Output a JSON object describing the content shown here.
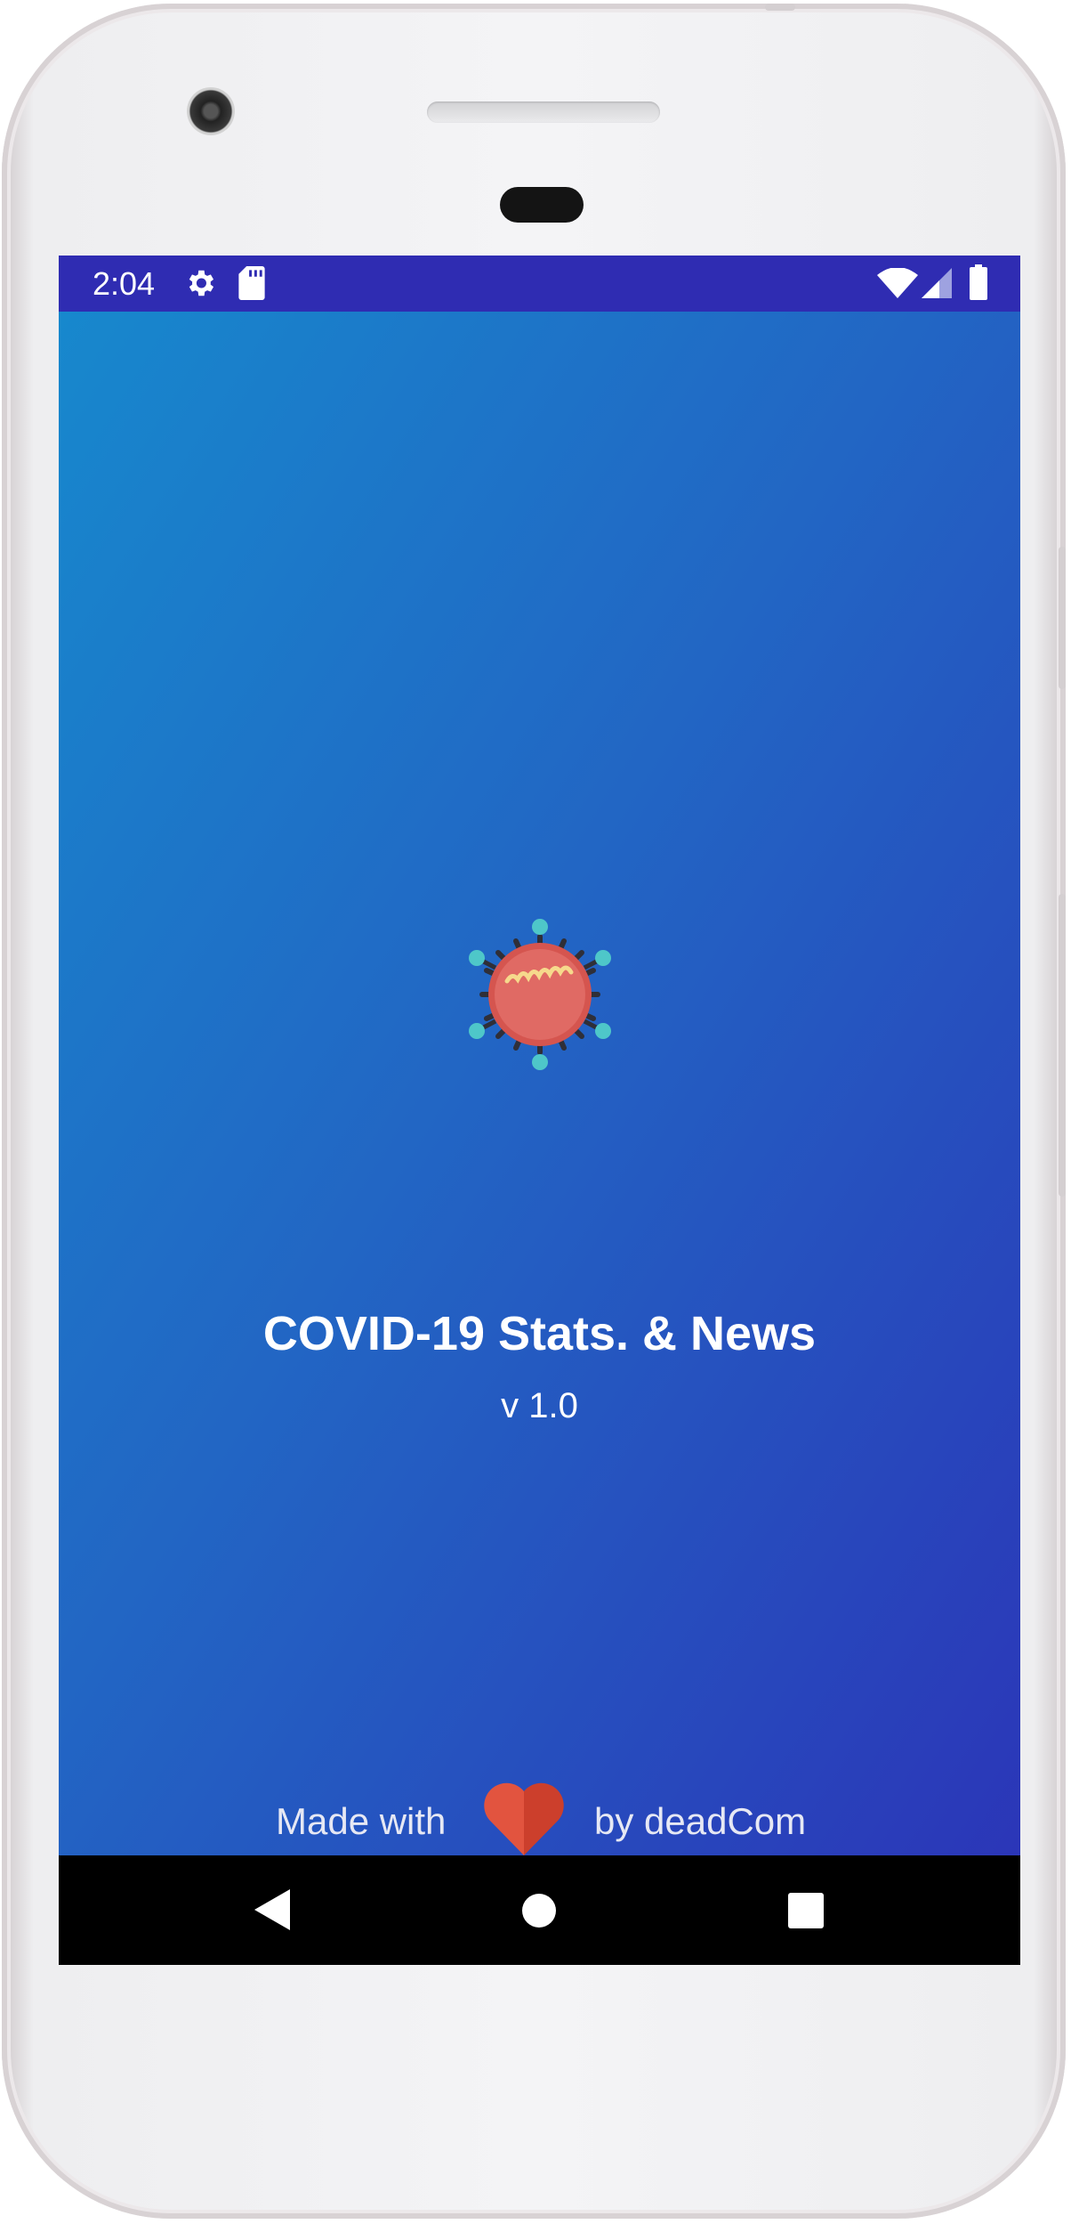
{
  "status_bar": {
    "time": "2:04",
    "icons": [
      "settings-icon",
      "sd-card-icon",
      "wifi-icon",
      "cell-signal-icon",
      "battery-icon"
    ],
    "background": "#2f2cb2"
  },
  "app": {
    "title": "COVID-19 Stats. & News",
    "version": "v 1.0",
    "footer_prefix": "Made with",
    "footer_suffix": "by deadCom",
    "logo_icon": "virus-icon",
    "heart_icon": "heart-icon",
    "gradient_top": "#1788cd",
    "gradient_bottom": "#2b36b8"
  },
  "nav_bar": {
    "buttons": [
      "back-button",
      "home-button",
      "recents-button"
    ]
  }
}
